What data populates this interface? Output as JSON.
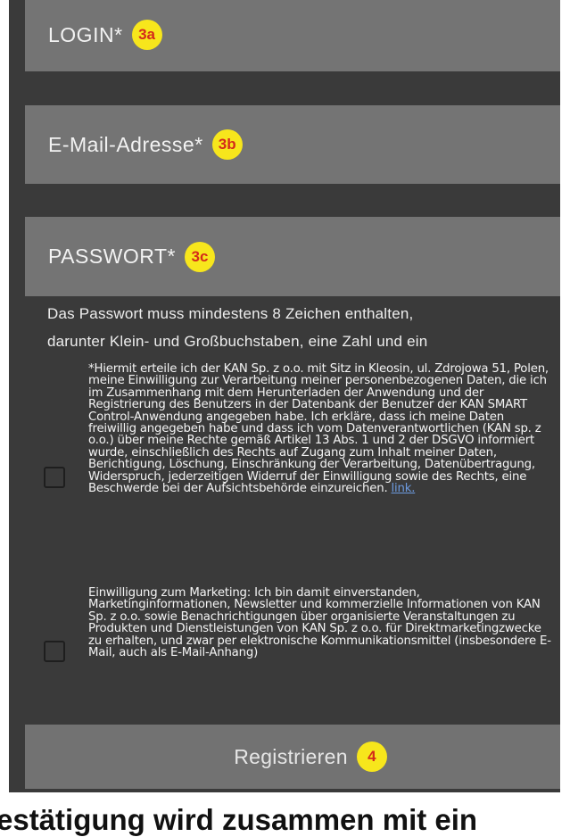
{
  "form": {
    "login_label": "LOGIN*",
    "login_badge": "3a",
    "email_label": "E-Mail-Adresse*",
    "email_badge": "3b",
    "password_label": "PASSWORT*",
    "password_badge": "3c",
    "password_hint_line1": "Das Passwort muss mindestens 8 Zeichen enthalten,",
    "password_hint_line2": "darunter Klein- und Großbuchstaben, eine Zahl und ein"
  },
  "consents": [
    {
      "text": "*Hiermit erteile ich der KAN Sp. z o.o. mit Sitz in Kleosin, ul. Zdrojowa 51, Polen, meine Einwilligung zur Verarbeitung meiner personenbezogenen Daten, die ich im Zusammenhang mit dem Herunterladen der Anwendung und der Registrierung des Benutzers in der Datenbank der Benutzer der KAN SMART Control-Anwendung angegeben habe. Ich erkläre, dass ich meine Daten freiwillig angegeben habe und dass ich vom Datenverantwortlichen (KAN sp. z o.o.) über meine Rechte gemäß Artikel 13 Abs. 1 und 2 der DSGVO informiert wurde, einschließlich des Rechts auf Zugang zum Inhalt meiner Daten, Berichtigung, Löschung, Einschränkung der Verarbeitung, Datenübertragung, Widerspruch, jederzeitigen Widerruf der Einwilligung sowie des Rechts, eine Beschwerde bei der Aufsichtsbehörde einzureichen.",
      "link_label": "link.",
      "checked": false
    },
    {
      "text": "Einwilligung zum Marketing: Ich bin damit einverstanden, Marketinginformationen, Newsletter und kommerzielle Informationen von KAN Sp. z o.o. sowie Benachrichtigungen über organisierte Veranstaltungen zu Produkten und Dienstleistungen von KAN Sp. z o.o. für Direktmarketingzwecke zu erhalten, und zwar per elektronische Kommunikationsmittel (insbesondere E-Mail, auch als E-Mail-Anhang)",
      "checked": false
    }
  ],
  "register": {
    "label": "Registrieren",
    "badge": "4"
  },
  "footer_text": "estätigung wird zusammen mit ein",
  "colors": {
    "background": "#3a3a3a",
    "field": "#747474",
    "badge": "#f7e61c",
    "badge_text": "#d42a1a",
    "link": "#6d9be0"
  }
}
